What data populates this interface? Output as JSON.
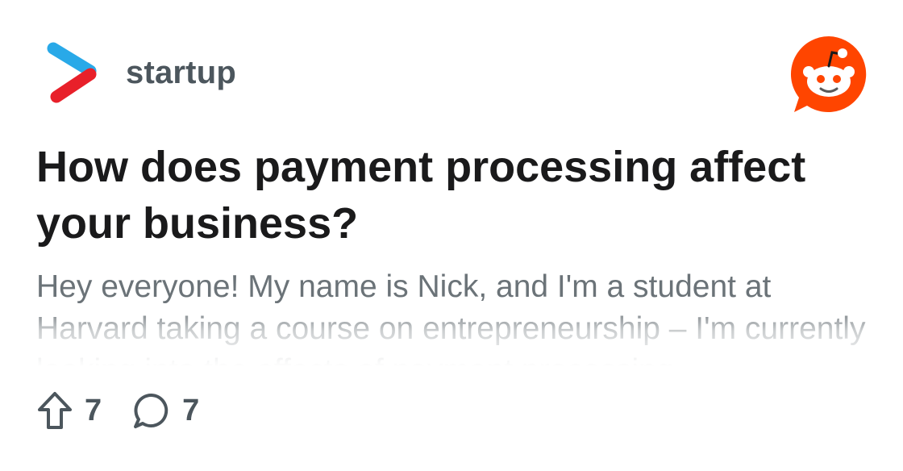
{
  "community": {
    "name": "startup",
    "logo_icon": "startup-chevron-logo-icon",
    "colors": {
      "chevron_top": "#29a9e8",
      "chevron_bottom": "#e8202a"
    }
  },
  "brand": {
    "icon": "reddit-snoo-icon",
    "color": "#ff4500"
  },
  "post": {
    "title": "How does payment processing affect your business?",
    "body": "Hey everyone! My name is Nick, and I'm a student at Harvard taking a course on entrepreneurship – I'm currently looking into the effects of payment processing"
  },
  "stats": {
    "upvotes": {
      "icon": "upvote-arrow-icon",
      "count": "7"
    },
    "comments": {
      "icon": "comment-bubble-icon",
      "count": "7"
    }
  }
}
